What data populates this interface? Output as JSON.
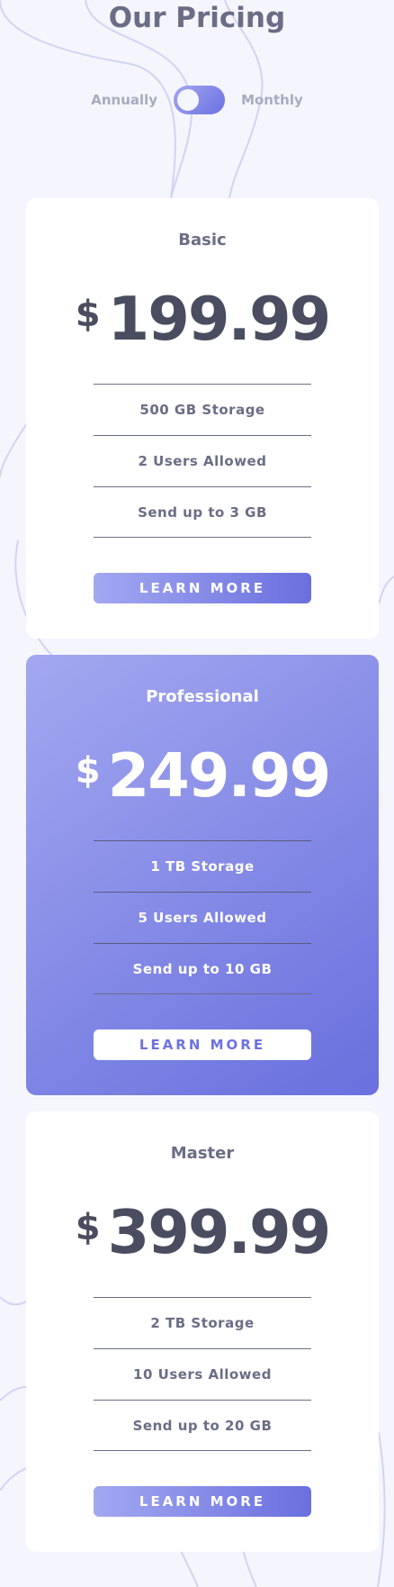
{
  "page": {
    "title": "Our Pricing"
  },
  "billing_toggle": {
    "left_label": "Annually",
    "right_label": "Monthly",
    "state": "annually"
  },
  "plans": [
    {
      "name": "Basic",
      "currency": "$",
      "price": "199.99",
      "features": [
        "500 GB Storage",
        "2 Users Allowed",
        "Send up to 3 GB"
      ],
      "button_label": "LEARN MORE",
      "featured": false
    },
    {
      "name": "Professional",
      "currency": "$",
      "price": "249.99",
      "features": [
        "1 TB Storage",
        "5 Users Allowed",
        "Send up to 10 GB"
      ],
      "button_label": "LEARN MORE",
      "featured": true
    },
    {
      "name": "Master",
      "currency": "$",
      "price": "399.99",
      "features": [
        "2 TB Storage",
        "10 Users Allowed",
        "Send up to 20 GB"
      ],
      "button_label": "LEARN MORE",
      "featured": false
    }
  ],
  "colors": {
    "background": "#f5f5fe",
    "accent_start": "#a3a8f0",
    "accent_end": "#6a6fdf",
    "heading": "#6b6d86",
    "price": "#4a4d60"
  }
}
